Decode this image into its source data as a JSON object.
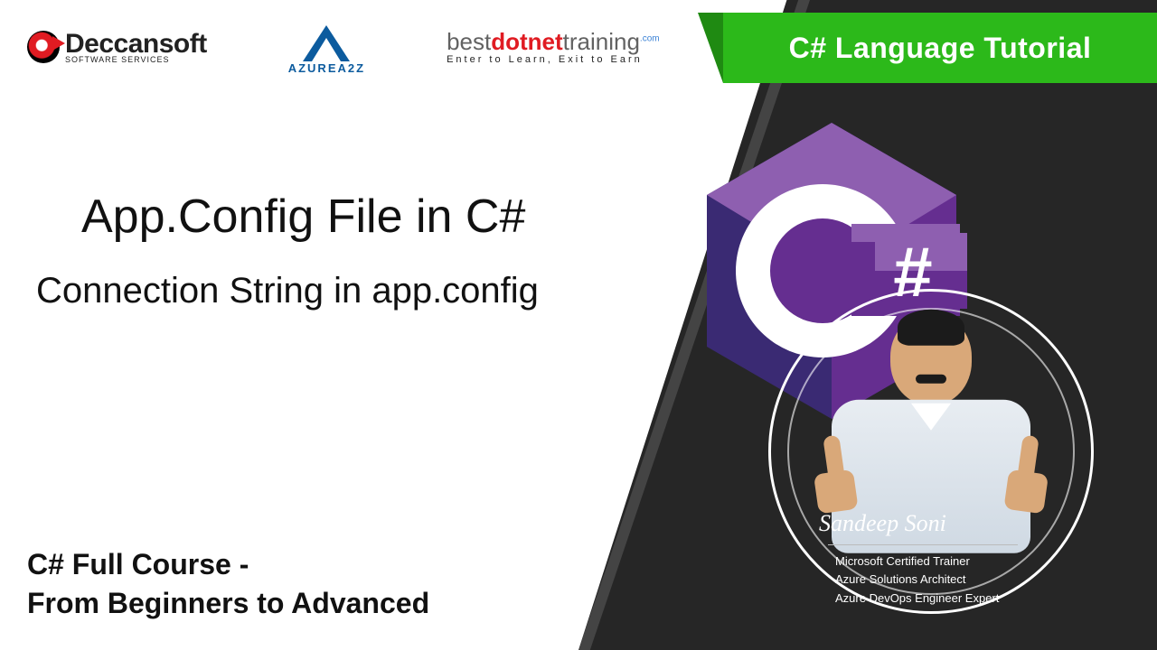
{
  "header": {
    "deccansoft": {
      "name": "Deccansoft",
      "tagline": "SOFTWARE SERVICES"
    },
    "azure": {
      "label": "AZUREA2Z"
    },
    "bdt": {
      "part_best": "best",
      "part_dotnet": "dotnet",
      "part_training": "training",
      "dot_com": ".com",
      "tagline": "Enter to Learn, Exit to Earn"
    }
  },
  "banner": "C# Language Tutorial",
  "titles": {
    "main": "App.Config File in C#",
    "sub": "Connection String in app.config"
  },
  "course": {
    "line1": "C# Full Course -",
    "line2": "From Beginners to Advanced"
  },
  "logo": {
    "hash": "#"
  },
  "presenter": {
    "name": "Sandeep Soni",
    "cred1": "Microsoft Certified Trainer",
    "cred2": "Azure Solutions Architect",
    "cred3": "Azure DevOps Engineer Expert"
  }
}
